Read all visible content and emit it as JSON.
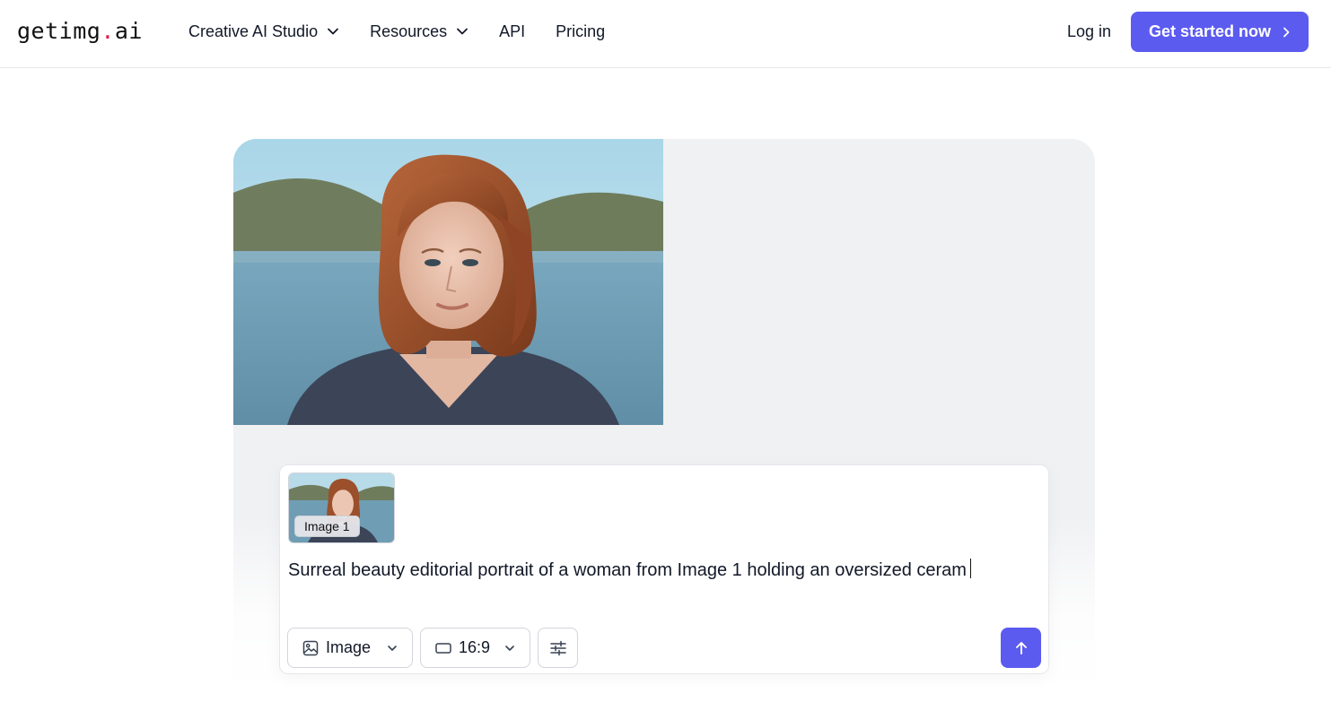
{
  "brand": {
    "name_main": "getimg",
    "name_dot": ".",
    "name_tld": "ai",
    "dot_color": "#e11d48"
  },
  "nav": {
    "items": [
      {
        "label": "Creative AI Studio",
        "has_dropdown": true
      },
      {
        "label": "Resources",
        "has_dropdown": true
      },
      {
        "label": "API",
        "has_dropdown": false
      },
      {
        "label": "Pricing",
        "has_dropdown": false
      }
    ],
    "login_label": "Log in",
    "cta_label": "Get started now"
  },
  "colors": {
    "accent": "#5b5bf0",
    "tile_bg": "#f0f1f3",
    "border": "#e5e7eb"
  },
  "prompt_box": {
    "attachment": {
      "badge": "Image 1",
      "icon": "portrait-thumbnail"
    },
    "text": "Surreal beauty editorial portrait of a woman from Image 1 holding an oversized ceram",
    "type_select": {
      "icon": "image-icon",
      "value": "Image"
    },
    "ratio_select": {
      "icon": "aspect-ratio-icon",
      "value": "16:9"
    },
    "settings_icon": "sliders-icon",
    "send_icon": "arrow-up-icon"
  }
}
